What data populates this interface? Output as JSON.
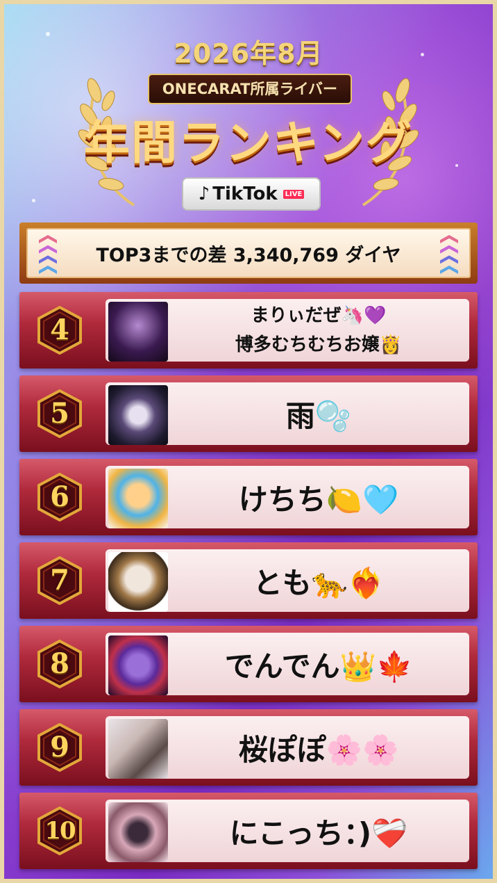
{
  "header": {
    "year_month": "2026年8月",
    "agency": "ONECARAT所属ライバー",
    "title": "年間ランキング",
    "platform_icon": "tiktok-note-icon",
    "platform": "TikTok",
    "live_badge": "LIVE"
  },
  "gap_banner": {
    "text": "TOP3までの差 3,340,769 ダイヤ"
  },
  "rankings": [
    {
      "rank": "4",
      "name_line1": "まりぃだぜ🦄💜",
      "name_line2": "博多むちむちお嬢👸"
    },
    {
      "rank": "5",
      "name": "雨🫧"
    },
    {
      "rank": "6",
      "name": "けちち🍋🩵"
    },
    {
      "rank": "7",
      "name": "とも🐆❤️‍🔥"
    },
    {
      "rank": "8",
      "name": "でんでん👑🍁"
    },
    {
      "rank": "9",
      "name": "桜ぽぽ🌸🌸"
    },
    {
      "rank": "10",
      "name": "にこっち：)❤️‍🩹"
    }
  ],
  "colors": {
    "gold": "#ffd45e",
    "row_red": "#b02a3c",
    "card_pink": "#fbeff0"
  }
}
